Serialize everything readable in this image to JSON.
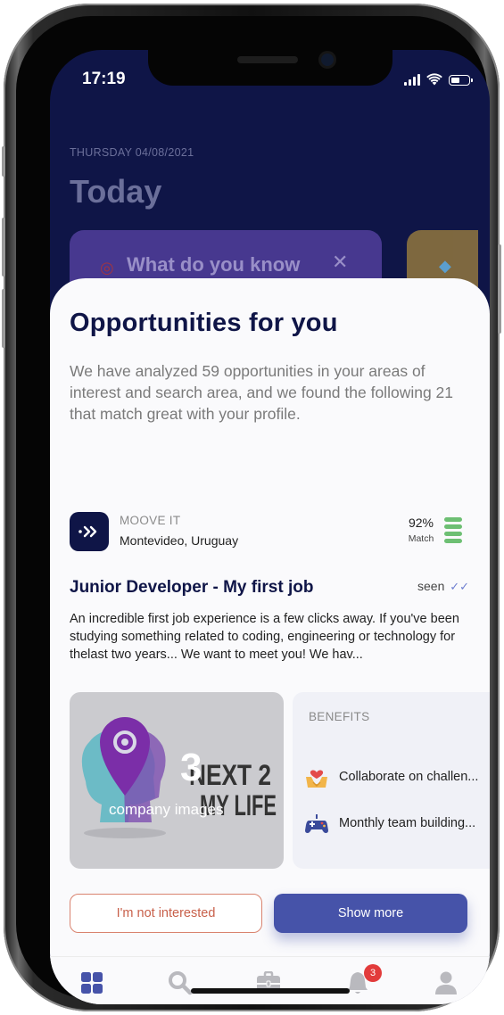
{
  "status_bar": {
    "time": "17:19"
  },
  "today": {
    "date": "THURSDAY 04/08/2021",
    "title": "Today",
    "quiz_card_text": "What do you know"
  },
  "sheet": {
    "title": "Opportunities for you",
    "description": "We have analyzed 59 opportunities in your areas of interest and search area, and we found the following 21 that match great with your profile."
  },
  "job": {
    "company_name": "MOOVE IT",
    "location": "Montevideo, Uruguay",
    "match_percent": "92%",
    "match_label": "Match",
    "match_fraction": 0.92,
    "title": "Junior Developer - My first job",
    "seen_label": "seen",
    "description": "An incredible first job experience is a few clicks away. If you've been studying something related to coding, engineering or technology for thelast two years... We want to meet you! We hav...",
    "images_count": "3",
    "images_caption": "company images",
    "image_brand": "NEXT 2 MY LIFE",
    "benefits_title": "BENEFITS",
    "benefits": [
      {
        "icon": "handshake-heart-icon",
        "text": "Collaborate on challen..."
      },
      {
        "icon": "gamepad-icon",
        "text": "Monthly team building..."
      }
    ]
  },
  "actions": {
    "not_interested": "I'm not interested",
    "show_more": "Show more"
  },
  "tabbar": {
    "items": [
      "dashboard-icon",
      "search-icon",
      "briefcase-icon",
      "bell-icon",
      "profile-icon"
    ],
    "active": "dashboard-icon",
    "notifications_badge": "3"
  },
  "colors": {
    "navy": "#0f1547",
    "primary_button": "#4653a9",
    "outline_button": "#d9836f",
    "match_green": "#6dbf73",
    "badge_red": "#e23b3b"
  }
}
